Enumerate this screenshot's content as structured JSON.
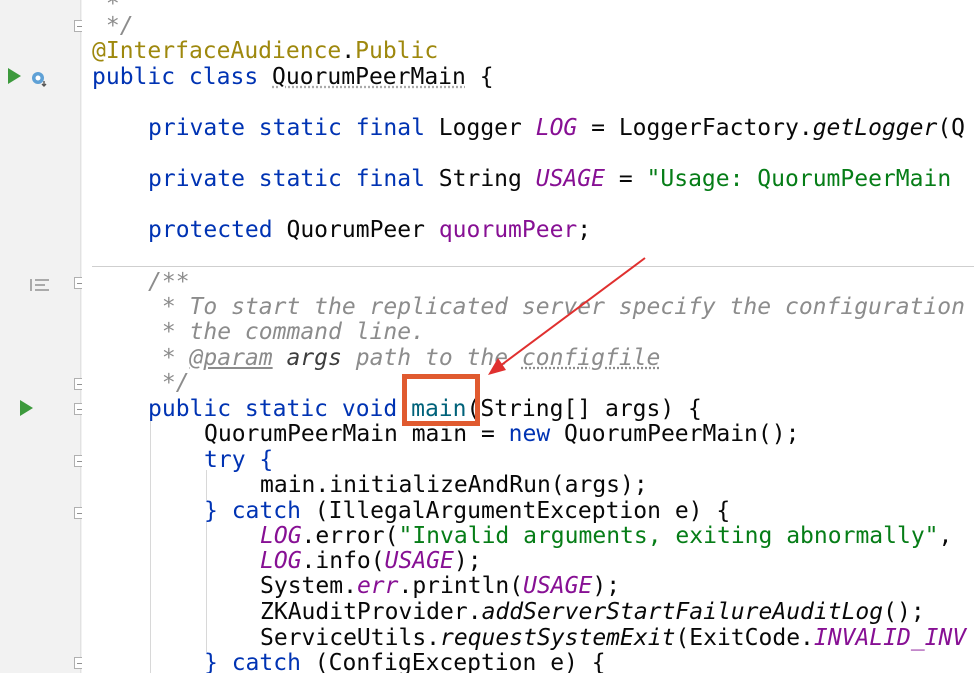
{
  "code": {
    "comment_star": " *",
    "comment_end": " */",
    "annotation_at": "@",
    "annotation_name": "InterfaceAudience",
    "annotation_dot": ".",
    "annotation_member": "Public",
    "class_kw": "public class ",
    "class_name": "QuorumPeerMain",
    "class_brace": " {",
    "log_kw": "private static final ",
    "log_type": "Logger ",
    "log_field": "LOG",
    "log_eq": " = LoggerFactory.",
    "log_call": "getLogger",
    "log_rest": "(Q",
    "usage_kw": "private static final ",
    "usage_type": "String ",
    "usage_field": "USAGE",
    "usage_eq": " = ",
    "usage_str": "\"Usage: QuorumPeerMain ",
    "qp_kw": "protected ",
    "qp_type": "QuorumPeer ",
    "qp_field": "quorumPeer",
    "qp_semi": ";",
    "doc_open": "/**",
    "doc_line1": " * To start the replicated server specify the configuration",
    "doc_line2": " * the command line.",
    "doc_line3_star": " * ",
    "doc_param_tag": "@param",
    "doc_param_name": " args",
    "doc_line3_rest": " path to the ",
    "doc_line3_link": "configfile",
    "doc_close": " */",
    "main_kw": "public static void ",
    "main_name": "main",
    "main_sig": "(String[] args) {",
    "l1_text": "QuorumPeerMain main = ",
    "l1_new": "new ",
    "l1_rest": "QuorumPeerMain();",
    "try_kw": "try ",
    "try_brace": "{",
    "init_call": "main.initializeAndRun(args);",
    "catch1_brace": "} ",
    "catch1_kw": "catch ",
    "catch1_rest": "(IllegalArgumentException e) {",
    "err_field": "LOG",
    "err_call": ".error(",
    "err_str": "\"Invalid arguments, exiting abnormally\"",
    "err_rest": ",",
    "info_field": "LOG",
    "info_call": ".info(",
    "info_arg": "USAGE",
    "info_end": ");",
    "sys_text": "System.",
    "sys_err": "err",
    "sys_println": ".println(",
    "sys_arg": "USAGE",
    "sys_end": ");",
    "zk_text": "ZKAuditProvider.",
    "zk_call": "addServerStartFailureAuditLog",
    "zk_end": "();",
    "su_text": "ServiceUtils.",
    "su_call": "requestSystemExit",
    "su_mid": "(ExitCode.",
    "su_field": "INVALID_INV",
    "catch2_brace": "} ",
    "catch2_kw": "catch ",
    "catch2_rest": "(ConfigException e) {"
  },
  "colors": {
    "highlight": "#e05a2f",
    "arrow": "#e0302f"
  }
}
